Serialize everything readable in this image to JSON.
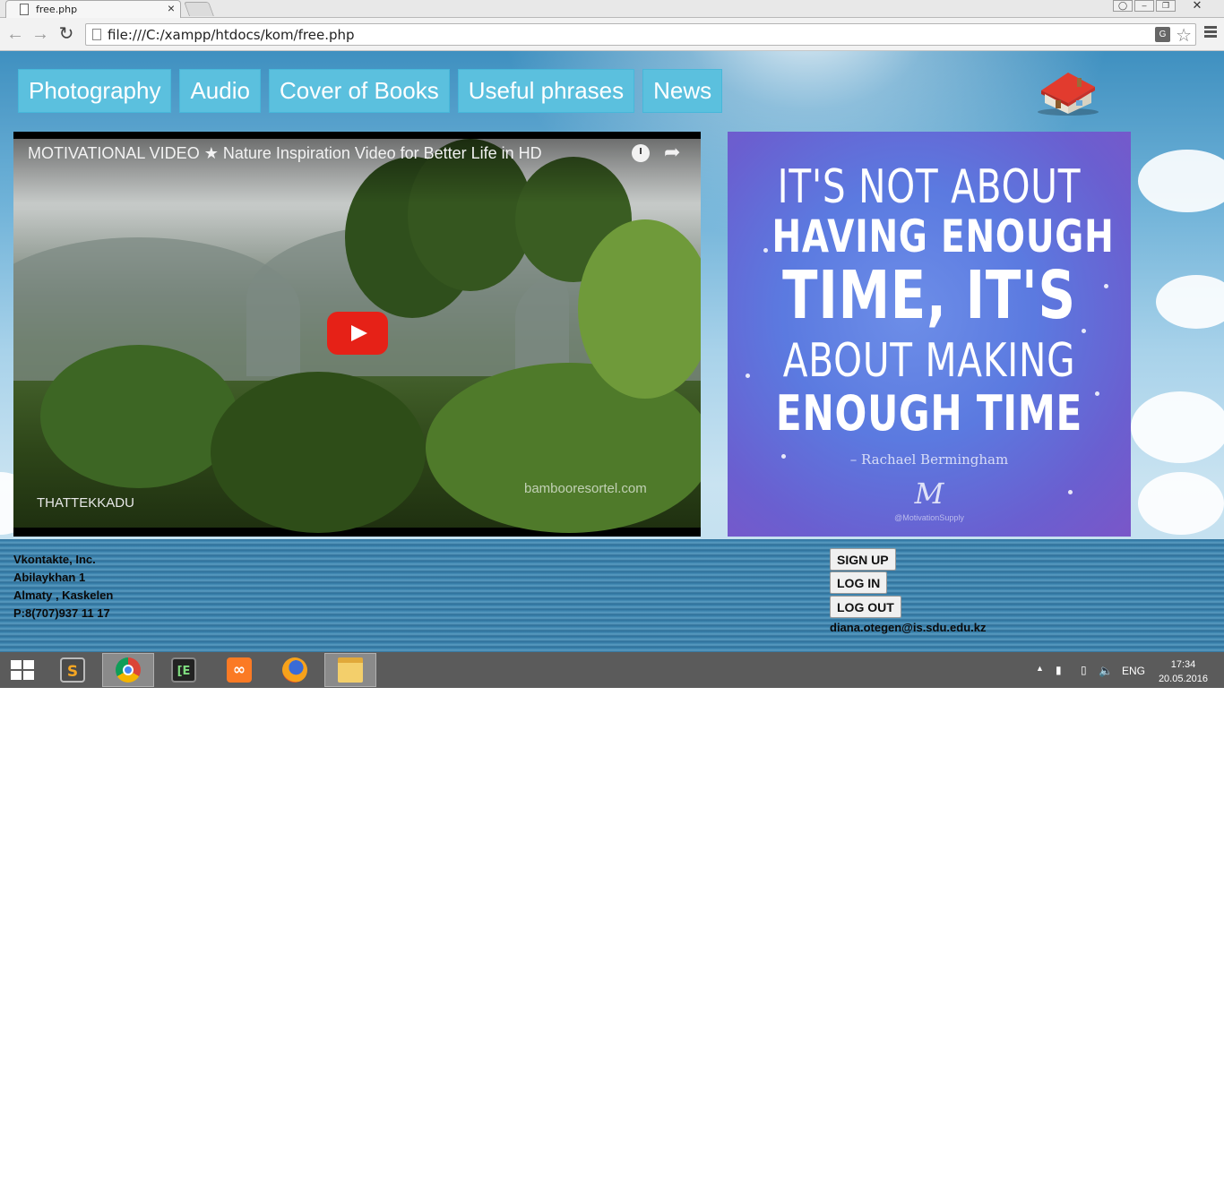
{
  "browser": {
    "tab_title": "free.php",
    "tab_close": "×",
    "url": "file:///C:/xampp/htdocs/kom/free.php",
    "back": "←",
    "forward": "→",
    "reload": "↻",
    "star": "☆",
    "translate": "G"
  },
  "nav": {
    "items": [
      "Photography",
      "Audio",
      "Cover of Books",
      "Useful phrases",
      "News"
    ]
  },
  "video": {
    "title": "MOTIVATIONAL VIDEO ★ Nature Inspiration Video for Better Life in HD",
    "share": "➦",
    "caption_left": "THATTEKKADU",
    "caption_right": "bambooresortel.com"
  },
  "quote": {
    "lines": [
      "IT'S NOT ABOUT",
      "HAVING ENOUGH",
      "TIME, IT'S",
      "ABOUT MAKING",
      "ENOUGH TIME"
    ],
    "author": "– Rachael Bermingham",
    "logo": "M",
    "mark": "@MotivationSupply"
  },
  "footer": {
    "address": [
      "Vkontakte, Inc.",
      "Abilaykhan 1",
      "Almaty , Kaskelen",
      "P:8(707)937 11 17"
    ],
    "sign_up": "SIGN UP",
    "log_in": "LOG IN",
    "log_out": "LOG OUT",
    "email": "diana.otegen@is.sdu.edu.kz"
  },
  "taskbar": {
    "apps": [
      "sublime-text",
      "chrome",
      "terminal",
      "xampp",
      "firefox",
      "file-explorer"
    ],
    "language": "ENG",
    "time": "17:34",
    "date": "20.05.2016"
  },
  "colors": {
    "nav_button": "#5bc0de",
    "play_button": "#e62117",
    "taskbar": "#5b5b5b"
  }
}
